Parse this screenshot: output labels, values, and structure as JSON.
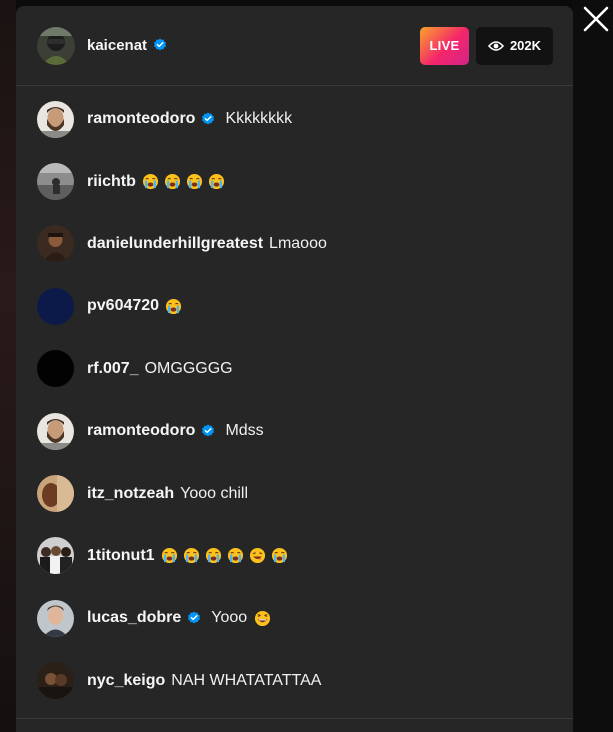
{
  "host": {
    "username": "kaicenat",
    "verified": true,
    "live_label": "LIVE",
    "viewer_count": "202K"
  },
  "comments": [
    {
      "username": "ramonteodoro",
      "verified": true,
      "text": "Kkkkkkkk",
      "emojis": [],
      "avatar": "beard-man"
    },
    {
      "username": "riichtb",
      "verified": false,
      "text": "",
      "emojis": [
        "crying",
        "crying",
        "crying",
        "crying"
      ],
      "avatar": "grey-photo"
    },
    {
      "username": "danielunderhillgreatest",
      "verified": false,
      "text": "Lmaooo",
      "emojis": [],
      "avatar": "brown-photo"
    },
    {
      "username": "pv604720",
      "verified": false,
      "text": "",
      "emojis": [
        "crying"
      ],
      "avatar": "navy-solid"
    },
    {
      "username": "rf.007_",
      "verified": false,
      "text": "OMGGGGG",
      "emojis": [],
      "avatar": "black-solid"
    },
    {
      "username": "ramonteodoro",
      "verified": true,
      "text": "Mdss",
      "emojis": [],
      "avatar": "beard-man"
    },
    {
      "username": "itz_notzeah",
      "verified": false,
      "text": "Yooo chill",
      "emojis": [],
      "avatar": "tan-photo"
    },
    {
      "username": "1titonut1",
      "verified": false,
      "text": "",
      "emojis": [
        "crying",
        "crying",
        "crying",
        "crying",
        "grin",
        "crying"
      ],
      "avatar": "group-photo"
    },
    {
      "username": "lucas_dobre",
      "verified": true,
      "text": "Yooo",
      "emojis": [
        "laughing"
      ],
      "avatar": "young-man"
    },
    {
      "username": "nyc_keigo",
      "verified": false,
      "text": "NAH WHATATATTAA",
      "emojis": [],
      "avatar": "dark-photo"
    }
  ],
  "colors": {
    "panel": "#262626",
    "verified": "#0095f6",
    "live_gradient_start": "#f9a42b",
    "live_gradient_end": "#d2248a"
  },
  "icons": {
    "close": "close-icon",
    "eye": "eye-icon",
    "verified": "verified-badge-icon"
  }
}
